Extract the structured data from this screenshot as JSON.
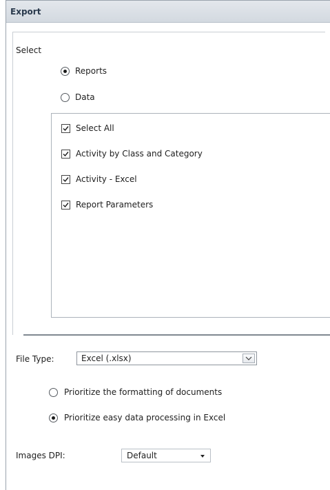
{
  "dialog": {
    "title": "Export"
  },
  "select_section": {
    "label": "Select",
    "radio_options": [
      {
        "label": "Reports",
        "selected": true
      },
      {
        "label": "Data",
        "selected": false
      }
    ],
    "checklist": [
      {
        "label": "Select All",
        "checked": true
      },
      {
        "label": "Activity by Class and Category",
        "checked": true
      },
      {
        "label": "Activity - Excel",
        "checked": true
      },
      {
        "label": "Report Parameters",
        "checked": true
      }
    ]
  },
  "file_type": {
    "label": "File Type:",
    "value": "Excel (.xlsx)",
    "options": [
      {
        "label": "Prioritize the formatting of documents",
        "selected": false
      },
      {
        "label": "Prioritize easy data processing in Excel",
        "selected": true
      }
    ]
  },
  "images_dpi": {
    "label": "Images DPI:",
    "value": "Default"
  }
}
